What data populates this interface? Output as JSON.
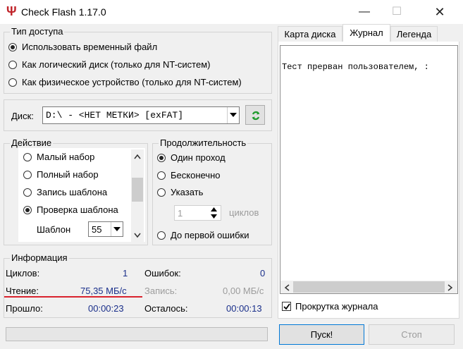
{
  "window": {
    "title": "Check Flash 1.17.0",
    "icon": "usb-trident-icon",
    "minimize_glyph": "—",
    "maximize_glyph": "☐",
    "close_glyph": "✕"
  },
  "access_type": {
    "legend": "Тип доступа",
    "options": [
      {
        "label": "Использовать временный файл",
        "selected": true
      },
      {
        "label": "Как логический диск (только для NT-систем)",
        "selected": false
      },
      {
        "label": "Как физическое устройство (только для NT-систем)",
        "selected": false
      }
    ]
  },
  "disk": {
    "label": "Диск:",
    "value": "D:\\ - <НЕТ МЕТКИ> [exFAT]",
    "refresh_icon": "refresh-icon"
  },
  "action": {
    "legend": "Действие",
    "options": [
      {
        "label": "Малый набор",
        "selected": false
      },
      {
        "label": "Полный набор",
        "selected": false
      },
      {
        "label": "Запись шаблона",
        "selected": false
      },
      {
        "label": "Проверка шаблона",
        "selected": true
      }
    ],
    "pattern_label": "Шаблон",
    "pattern_value": "55"
  },
  "duration": {
    "legend": "Продолжительность",
    "options": [
      {
        "label": "Один проход",
        "selected": true
      },
      {
        "label": "Бесконечно",
        "selected": false
      },
      {
        "label": "Указать",
        "selected": false
      },
      {
        "label": "До первой ошибки",
        "selected": false
      }
    ],
    "cycles_value": "1",
    "cycles_label": "циклов"
  },
  "info": {
    "legend": "Информация",
    "cycles_label": "Циклов:",
    "cycles_value": "1",
    "errors_label": "Ошибок:",
    "errors_value": "0",
    "read_label": "Чтение:",
    "read_value": "75,35 МБ/с",
    "write_label": "Запись:",
    "write_value": "0,00 МБ/с",
    "elapsed_label": "Прошло:",
    "elapsed_value": "00:00:23",
    "remaining_label": "Осталось:",
    "remaining_value": "00:00:13",
    "underline_color": "#d9232d"
  },
  "tabs": [
    {
      "label": "Карта диска",
      "active": false
    },
    {
      "label": "Журнал",
      "active": true
    },
    {
      "label": "Легенда",
      "active": false
    }
  ],
  "log": {
    "text": "Тест прерван пользователем, :"
  },
  "scroll_log_label": "Прокрутка журнала",
  "scroll_log_checked": true,
  "start_button": "Пуск!",
  "stop_button": "Стоп"
}
